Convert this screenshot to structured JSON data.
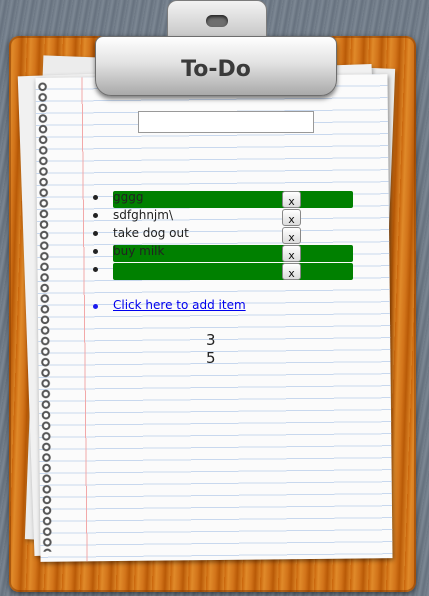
{
  "app": {
    "title": "To-Do",
    "input": {
      "value": "",
      "placeholder": ""
    }
  },
  "todos": [
    {
      "text": "gggg",
      "highlighted": true,
      "delete_label": "x"
    },
    {
      "text": "sdfghnjm\\",
      "highlighted": false,
      "delete_label": "x"
    },
    {
      "text": "take dog out",
      "highlighted": false,
      "delete_label": "x"
    },
    {
      "text": "buy milk",
      "highlighted": true,
      "delete_label": "x"
    },
    {
      "text": "",
      "highlighted": true,
      "delete_label": "x"
    }
  ],
  "add_link": "Click here to add item",
  "counts": [
    "3",
    "5"
  ],
  "colors": {
    "highlight": "#008000",
    "link": "#0000ee",
    "board": "#d2741a"
  }
}
